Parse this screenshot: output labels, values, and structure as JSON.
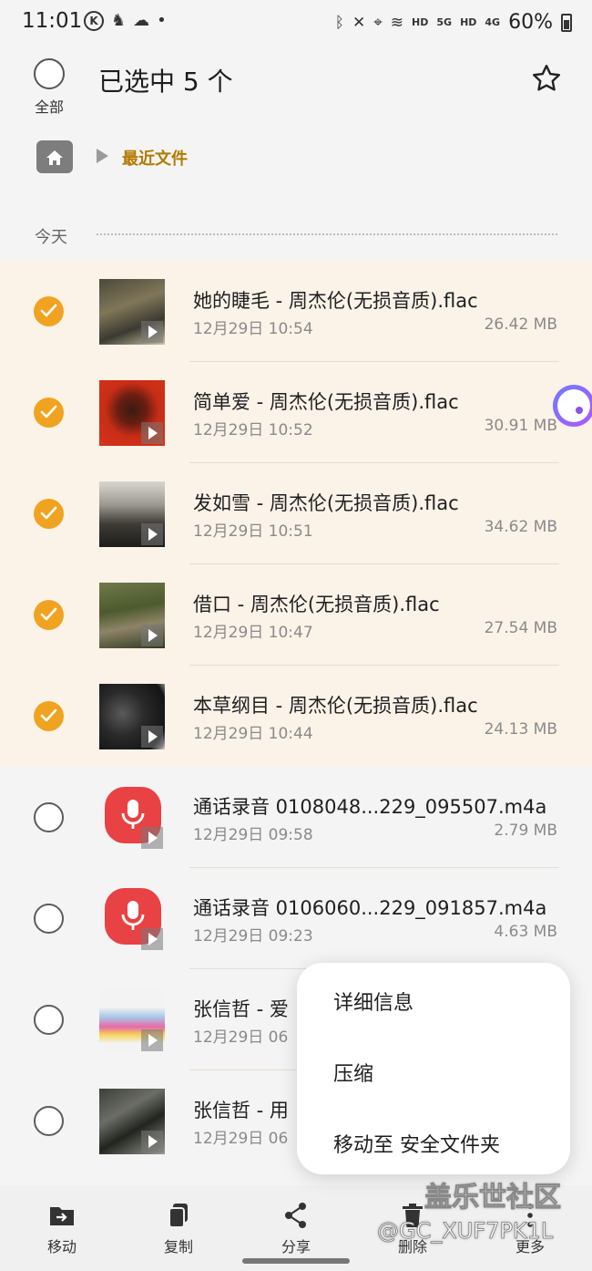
{
  "status_bar": {
    "time": "11:01",
    "left_icons": [
      "k-icon",
      "notification-icon",
      "cloud-icon"
    ],
    "network_labels": [
      "HD",
      "5G",
      "HD",
      "4G"
    ],
    "battery": "60%"
  },
  "header": {
    "select_all_label": "全部",
    "title": "已选中 5 个"
  },
  "breadcrumb": {
    "current": "最近文件"
  },
  "section": {
    "label": "今天"
  },
  "files": [
    {
      "name": "她的睫毛 - 周杰伦(无损音质).flac",
      "date": "12月29日 10:54",
      "size": "26.42 MB",
      "selected": true,
      "type": "album-art"
    },
    {
      "name": "简单爱 - 周杰伦(无损音质).flac",
      "date": "12月29日 10:52",
      "size": "30.91 MB",
      "selected": true,
      "type": "album-art"
    },
    {
      "name": "发如雪 - 周杰伦(无损音质).flac",
      "date": "12月29日 10:51",
      "size": "34.62 MB",
      "selected": true,
      "type": "album-art"
    },
    {
      "name": "借口 - 周杰伦(无损音质).flac",
      "date": "12月29日 10:47",
      "size": "27.54 MB",
      "selected": true,
      "type": "album-art"
    },
    {
      "name": "本草纲目 - 周杰伦(无损音质).flac",
      "date": "12月29日 10:44",
      "size": "24.13 MB",
      "selected": true,
      "type": "album-art"
    },
    {
      "name": "通话录音 0108048...229_095507.m4a",
      "date": "12月29日 09:58",
      "size": "2.79 MB",
      "selected": false,
      "type": "voice-recorder"
    },
    {
      "name": "通话录音 0106060...229_091857.m4a",
      "date": "12月29日 09:23",
      "size": "4.63 MB",
      "selected": false,
      "type": "voice-recorder"
    },
    {
      "name": "张信哲 - 爱",
      "date": "12月29日 06",
      "size": "",
      "selected": false,
      "type": "album-art"
    },
    {
      "name": "张信哲 - 用",
      "date": "12月29日 06",
      "size": "",
      "selected": false,
      "type": "album-art"
    }
  ],
  "popup_menu": {
    "items": [
      "详细信息",
      "压缩",
      "移动至 安全文件夹"
    ]
  },
  "bottom_bar": {
    "move": "移动",
    "copy": "复制",
    "share": "分享",
    "delete": "删除",
    "more": "更多"
  },
  "watermark": {
    "line1": "盖乐世社区",
    "line2": "@GC_XUF7PK1L"
  },
  "colors": {
    "accent": "#f0a320",
    "breadcrumb": "#b37a00",
    "selected_row": "#fbf2e8",
    "recorder": "#e84244"
  }
}
